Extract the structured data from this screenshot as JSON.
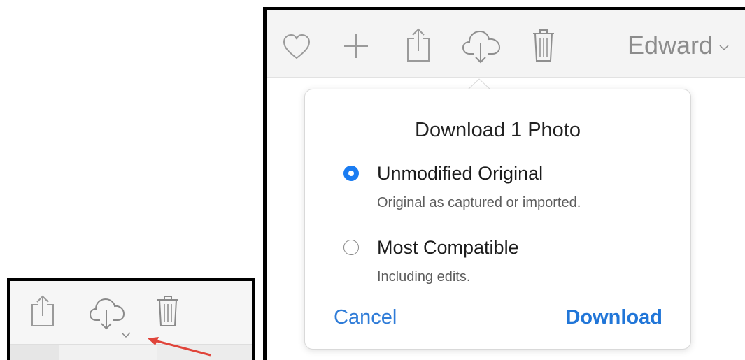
{
  "inset": {
    "icons": [
      "share-icon",
      "cloud-download-icon",
      "chevron-down-icon",
      "trash-icon"
    ]
  },
  "toolbar": {
    "icons": [
      "heart-icon",
      "plus-icon",
      "share-icon",
      "cloud-download-icon",
      "trash-icon"
    ],
    "user_name": "Edward"
  },
  "popover": {
    "title": "Download 1 Photo",
    "options": [
      {
        "label": "Unmodified Original",
        "description": "Original as captured or imported.",
        "selected": true
      },
      {
        "label": "Most Compatible",
        "description": "Including edits.",
        "selected": false
      }
    ],
    "cancel_label": "Cancel",
    "download_label": "Download"
  },
  "colors": {
    "accent_blue": "#1a7cf2",
    "link_blue": "#2f7cd8",
    "icon_gray": "#8c8c8c",
    "pointer_red": "#e0443a"
  }
}
